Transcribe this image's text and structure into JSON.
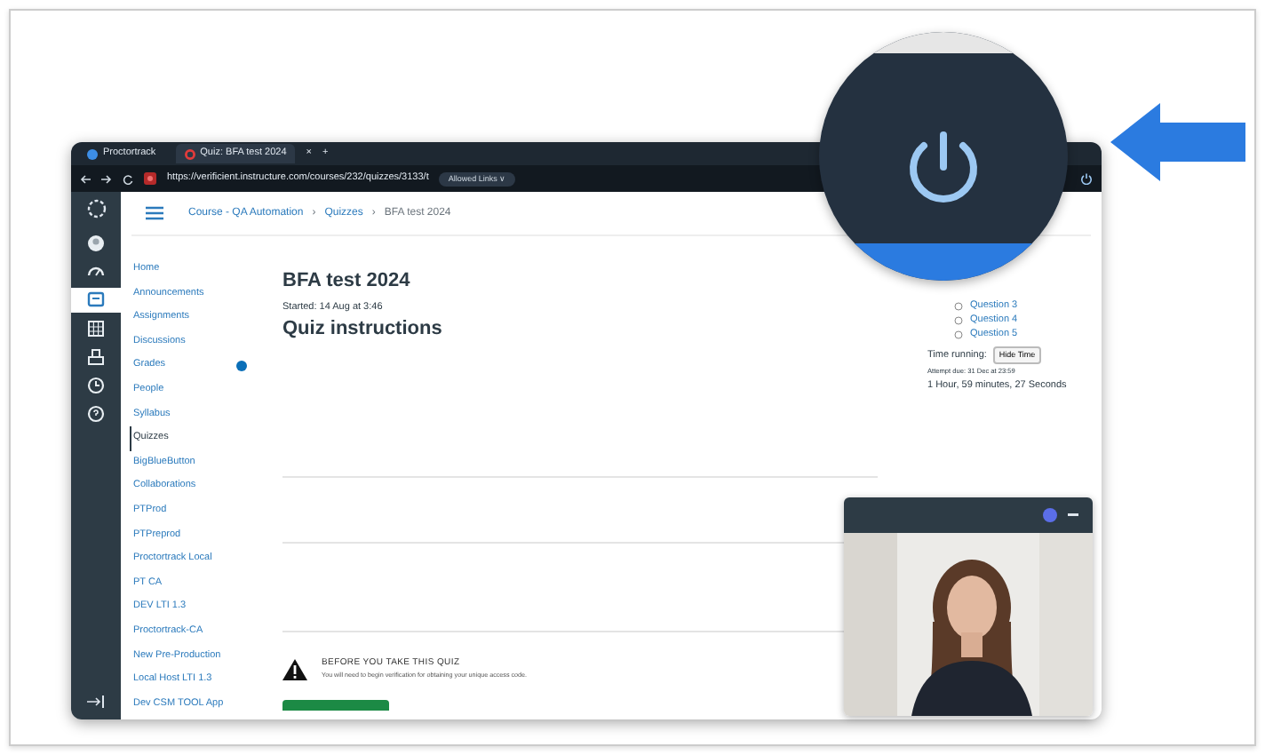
{
  "browser": {
    "tabs": [
      {
        "label": "Proctortrack",
        "selected": false,
        "closable": false
      },
      {
        "label": "Quiz: BFA test 2024",
        "selected": true,
        "closable": true
      }
    ],
    "close_tab": "×",
    "new_tab": "+",
    "url": "https://verificient.instructure.com/courses/232/quizzes/3133/t",
    "url_badge": "Allowed Links ∨"
  },
  "global_nav": [
    {
      "kind": "account",
      "selected": false
    },
    {
      "kind": "dashboard",
      "selected": false
    },
    {
      "kind": "courses",
      "selected": true
    },
    {
      "kind": "calendar",
      "selected": false
    },
    {
      "kind": "inbox",
      "selected": false
    },
    {
      "kind": "history",
      "selected": false
    },
    {
      "kind": "help",
      "selected": false
    }
  ],
  "breadcrumb": {
    "separator": "›",
    "items": [
      "Course - QA Automation",
      "Quizzes",
      "BFA test 2024"
    ]
  },
  "course_nav": [
    {
      "label": "Home",
      "selected": false,
      "badge": false
    },
    {
      "label": "Announcements",
      "selected": false,
      "badge": false
    },
    {
      "label": "Assignments",
      "selected": false,
      "badge": false
    },
    {
      "label": "Discussions",
      "selected": false,
      "badge": false
    },
    {
      "label": "Grades",
      "selected": false,
      "badge": true
    },
    {
      "label": "People",
      "selected": false,
      "badge": false
    },
    {
      "label": "Syllabus",
      "selected": false,
      "badge": false
    },
    {
      "label": "Quizzes",
      "selected": true,
      "badge": false
    },
    {
      "label": "BigBlueButton",
      "selected": false,
      "badge": false
    },
    {
      "label": "Collaborations",
      "selected": false,
      "badge": false
    },
    {
      "label": "PTProd",
      "selected": false,
      "badge": false
    },
    {
      "label": "PTPreprod",
      "selected": false,
      "badge": false
    },
    {
      "label": "Proctortrack Local",
      "selected": false,
      "badge": false
    },
    {
      "label": "PT CA",
      "selected": false,
      "badge": false
    },
    {
      "label": "DEV LTI 1.3",
      "selected": false,
      "badge": false
    },
    {
      "label": "Proctortrack-CA",
      "selected": false,
      "badge": false
    },
    {
      "label": "New Pre-Production",
      "selected": false,
      "badge": false
    },
    {
      "label": "Local Host LTI 1.3",
      "selected": false,
      "badge": false
    },
    {
      "label": "Dev CSM TOOL App",
      "selected": false,
      "badge": false
    }
  ],
  "quiz": {
    "title": "BFA test 2024",
    "started": "Started: 14 Aug at 3:46",
    "heading": "Quiz instructions",
    "warning_title": "BEFORE YOU TAKE THIS QUIZ",
    "warning_text": "You will need to begin verification for obtaining your unique access code."
  },
  "sidebar": {
    "questions": [
      "Question 3",
      "Question 4",
      "Question 5"
    ],
    "time_label": "Time running:",
    "hide_button": "Hide Time",
    "attempt_due": "Attempt due: 31 Dec at 23:59",
    "timer": "1 Hour, 59 minutes, 27 Seconds"
  }
}
